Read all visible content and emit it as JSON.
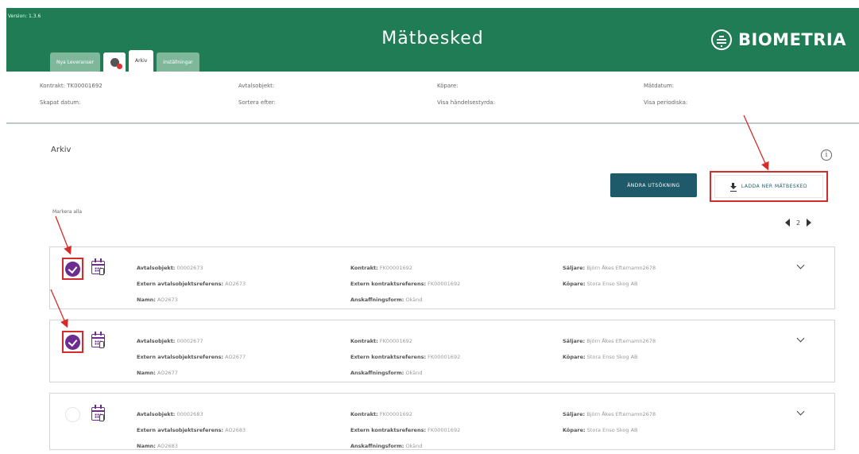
{
  "header": {
    "version": "Version: 1.3.6",
    "title": "Mätbesked",
    "logo_text": "BIOMETRIA",
    "tabs": [
      {
        "label": "Nya Leveranser",
        "active": false
      },
      {
        "label": "",
        "icon": "notification-icon",
        "active": false
      },
      {
        "label": "Arkiv",
        "active": true
      },
      {
        "label": "Inställningar",
        "active": false
      }
    ],
    "color": "#1f7c55"
  },
  "meta": [
    {
      "label": "Kontrakt: TK00001692"
    },
    {
      "label": "Avtalsobjekt:"
    },
    {
      "label": "Köpare:"
    },
    {
      "label": "Mätdatum:"
    },
    {
      "label": "Skapat datum:"
    },
    {
      "label": "Sortera efter:"
    },
    {
      "label": "Visa händelsestyrda:"
    },
    {
      "label": "Visa periodiska:"
    }
  ],
  "main": {
    "section_title": "Arkiv",
    "info_icon": "i",
    "change_button": "ÄNDRA UTSÖKNING",
    "download_button": "LADDA NER MÄTBESKED",
    "mark_all": "Markera alla",
    "pager": {
      "page": "2"
    }
  },
  "labels": {
    "avtalsobjekt": "Avtalsobjekt:",
    "extern_avtal": "Extern avtalsobjektsreferens:",
    "namn": "Namn:",
    "kontrakt": "Kontrakt:",
    "extern_kontrakt": "Extern kontraktsreferens:",
    "anskaffning": "Anskaffningsform:",
    "saljare": "Säljare:",
    "kopare": "Köpare:"
  },
  "cards": [
    {
      "checked": true,
      "avtalsobjekt": "00002673",
      "extern_avtal": "AO2673",
      "namn": "AO2673",
      "kontrakt": "FK00001692",
      "extern_kontrakt": "FK00001692",
      "anskaffning": "Okänd",
      "saljare": "Björn Åkes Efternamn2678",
      "kopare": "Stora Enso Skog AB"
    },
    {
      "checked": true,
      "avtalsobjekt": "00002677",
      "extern_avtal": "AO2677",
      "namn": "AO2677",
      "kontrakt": "FK00001692",
      "extern_kontrakt": "FK00001692",
      "anskaffning": "Okänd",
      "saljare": "Björn Åkes Efternamn2678",
      "kopare": "Stora Enso Skog AB"
    },
    {
      "checked": false,
      "avtalsobjekt": "00002683",
      "extern_avtal": "AO2683",
      "namn": "AO2683",
      "kontrakt": "FK00001692",
      "extern_kontrakt": "FK00001692",
      "anskaffning": "Okänd",
      "saljare": "Björn Åkes Efternamn2678",
      "kopare": "Stora Enso Skog AB"
    }
  ],
  "colors": {
    "accent": "#6e2b90",
    "button": "#1f5a6b",
    "highlight": "#d62b2b"
  }
}
